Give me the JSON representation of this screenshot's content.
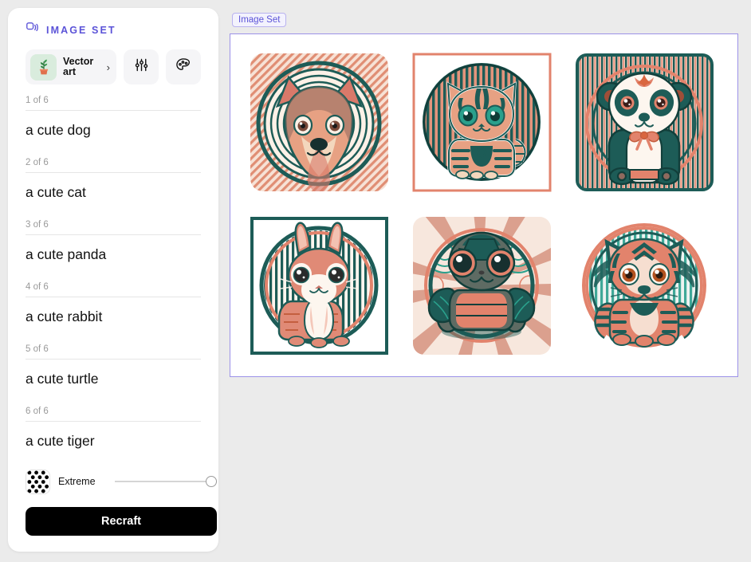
{
  "sidebar": {
    "header": {
      "icon": "layers-stack-icon",
      "title": "IMAGE SET"
    },
    "style_selector": {
      "thumb_icon": "potted-plant-icon",
      "label": "Vector art",
      "chevron": "›"
    },
    "toolbar": [
      {
        "name": "settings-sliders-button",
        "icon": "sliders-icon"
      },
      {
        "name": "palette-button",
        "icon": "palette-icon"
      }
    ],
    "prompts": [
      {
        "count": "1 of 6",
        "text": "a cute dog"
      },
      {
        "count": "2 of 6",
        "text": "a cute cat"
      },
      {
        "count": "3 of 6",
        "text": "a cute panda"
      },
      {
        "count": "4 of 6",
        "text": "a cute rabbit"
      },
      {
        "count": "5 of 6",
        "text": "a cute turtle"
      },
      {
        "count": "6 of 6",
        "text": "a cute tiger"
      }
    ],
    "extreme": {
      "icon": "polka-dot-swatch-icon",
      "label": "Extreme",
      "slider_value": 100
    },
    "recraft_label": "Recraft"
  },
  "canvas": {
    "tab_label": "Image Set",
    "border_color": "#9c92e8",
    "accent_color": "#5b53d8",
    "images": [
      {
        "name": "image-tile-dog",
        "subject": "a cute dog",
        "frame": "rounded-square-salmon-hatched"
      },
      {
        "name": "image-tile-cat",
        "subject": "a cute cat",
        "frame": "square-salmon-vertical-stripes"
      },
      {
        "name": "image-tile-panda",
        "subject": "a cute panda",
        "frame": "rounded-square-teal-vertical-stripes"
      },
      {
        "name": "image-tile-rabbit",
        "subject": "a cute rabbit",
        "frame": "square-teal-vertical-stripes"
      },
      {
        "name": "image-tile-turtle",
        "subject": "a cute turtle",
        "frame": "rounded-square-sunburst-rays"
      },
      {
        "name": "image-tile-tiger",
        "subject": "a cute tiger",
        "frame": "circle-teal-vertical-stripes"
      }
    ],
    "palette": {
      "teal": "#1d5c57",
      "salmon": "#e2836c",
      "cream": "#f6ded0",
      "dark_teal": "#123f3b",
      "gray_green": "#5e6b63"
    }
  }
}
